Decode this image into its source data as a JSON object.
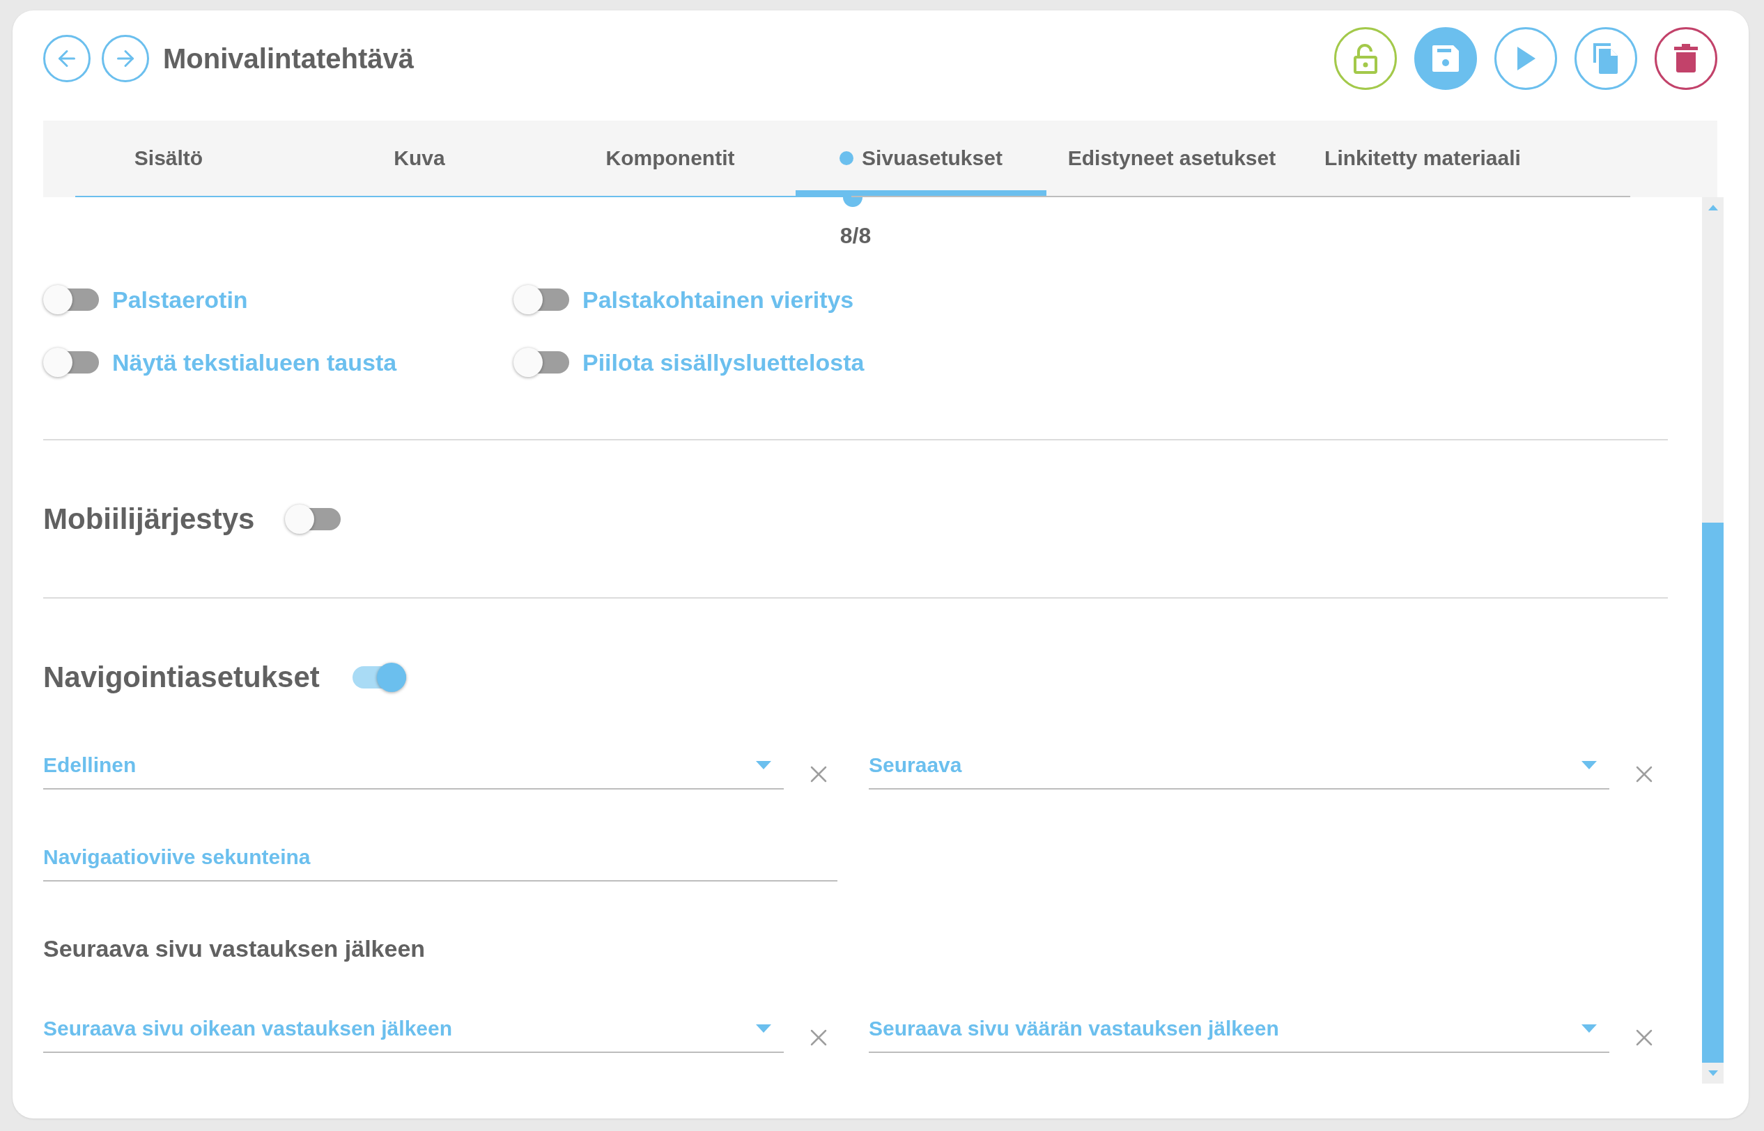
{
  "header": {
    "title": "Monivalintatehtävä"
  },
  "tabs": [
    {
      "label": "Sisältö",
      "selected": false
    },
    {
      "label": "Kuva",
      "selected": false
    },
    {
      "label": "Komponentit",
      "selected": false
    },
    {
      "label": "Sivuasetukset",
      "selected": true
    },
    {
      "label": "Edistyneet asetukset",
      "selected": false
    },
    {
      "label": "Linkitetty materiaali",
      "selected": false
    }
  ],
  "page_counter": "8/8",
  "toggles": [
    {
      "label": "Palstaerotin",
      "on": false
    },
    {
      "label": "Palstakohtainen vieritys",
      "on": false
    },
    {
      "label": "Näytä tekstialueen tausta",
      "on": false
    },
    {
      "label": "Piilota sisällysluettelosta",
      "on": false
    }
  ],
  "sections": [
    {
      "title": "Mobiilijärjestys",
      "on": false
    },
    {
      "title": "Navigointiasetukset",
      "on": true
    }
  ],
  "navigation": {
    "selects": [
      {
        "placeholder": "Edellinen"
      },
      {
        "placeholder": "Seuraava"
      }
    ],
    "delay_field": {
      "placeholder": "Navigaatioviive sekunteina"
    },
    "subheading": "Seuraava sivu vastauksen jälkeen",
    "after_answer_selects": [
      {
        "placeholder": "Seuraava sivu oikean vastauksen jälkeen"
      },
      {
        "placeholder": "Seuraava sivu väärän vastauksen jälkeen"
      }
    ]
  }
}
